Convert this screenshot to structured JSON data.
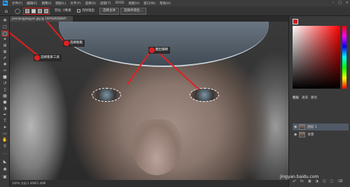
{
  "app": {
    "logo": "Ps"
  },
  "menubar": {
    "items": [
      "文件(F)",
      "编辑(E)",
      "图像(I)",
      "图层(L)",
      "文字(Y)",
      "选择(S)",
      "滤镜(T)",
      "3D(D)",
      "视图(V)",
      "窗口(W)",
      "帮助(H)"
    ]
  },
  "optbar": {
    "feather_label": "羽化: 0像素",
    "antialias_label": "消除锯齿",
    "subject_button": "选择主体",
    "mask_button": "选择并遮住..."
  },
  "document": {
    "tab_label": "jiemian@jingyan.jpg @ 100%(RGB/8#)"
  },
  "callouts": {
    "lasso_tool": "选择套索工具",
    "add_selection": "选择框框",
    "eyes_selection": "圈出眼睛"
  },
  "status": {
    "text": "100%   文档:1.46M/1.46M"
  },
  "panels": {
    "tabs": [
      "图层",
      "通道",
      "路径"
    ],
    "layers": [
      {
        "name": "图层 1",
        "selected": true
      },
      {
        "name": "背景",
        "selected": false
      }
    ]
  },
  "watermark": "jingyan.baidu.com",
  "colors": {
    "accent": "#e02020",
    "foreground": "#c81e1e"
  }
}
